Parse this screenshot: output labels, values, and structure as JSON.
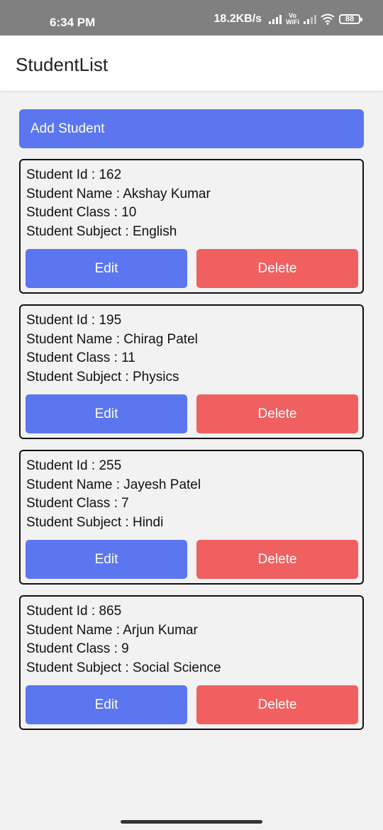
{
  "status_bar": {
    "time": "6:34 PM",
    "network_speed": "18.2KB/s",
    "vo_line1": "Vo",
    "vo_line2": "WiFi",
    "battery": "88",
    "icons": [
      "signal-icon",
      "vowifi-icon",
      "signal-icon",
      "wifi-icon",
      "battery-icon"
    ]
  },
  "app_bar": {
    "title": "StudentList"
  },
  "actions": {
    "add_label": "Add Student"
  },
  "colors": {
    "primary": "#5b76ee",
    "danger": "#f06060"
  },
  "students": [
    {
      "id": "Student Id : 162",
      "name": "Student Name : Akshay Kumar",
      "class": "Student Class : 10",
      "subject": "Student Subject : English",
      "edit": "Edit",
      "delete": "Delete"
    },
    {
      "id": "Student Id : 195",
      "name": "Student Name : Chirag Patel",
      "class": "Student Class : 11",
      "subject": "Student Subject : Physics",
      "edit": "Edit",
      "delete": "Delete"
    },
    {
      "id": "Student Id : 255",
      "name": "Student Name : Jayesh Patel",
      "class": "Student Class : 7",
      "subject": "Student Subject : Hindi",
      "edit": "Edit",
      "delete": "Delete"
    },
    {
      "id": "Student Id : 865",
      "name": "Student Name : Arjun Kumar",
      "class": "Student Class : 9",
      "subject": "Student Subject : Social Science",
      "edit": "Edit",
      "delete": "Delete"
    }
  ]
}
